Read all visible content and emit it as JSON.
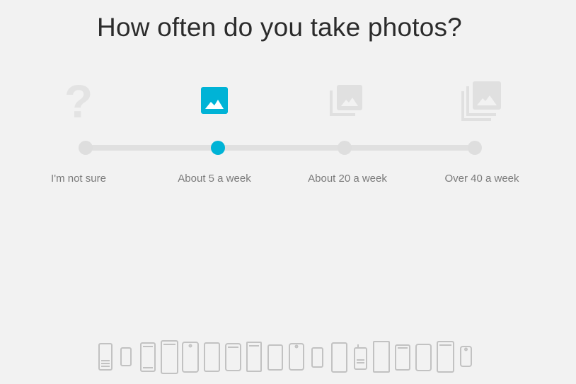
{
  "title": "How often do you take photos?",
  "accent_color": "#00b3d6",
  "inactive_color": "#dedede",
  "selected_index": 1,
  "options": [
    {
      "label": "I'm not sure",
      "icon": "question-mark-icon"
    },
    {
      "label": "About 5 a week",
      "icon": "single-photo-icon"
    },
    {
      "label": "About 20 a week",
      "icon": "photo-stack-icon"
    },
    {
      "label": "Over 40 a week",
      "icon": "photo-library-icon"
    }
  ],
  "devices_icon": "phone-lineup-icon"
}
